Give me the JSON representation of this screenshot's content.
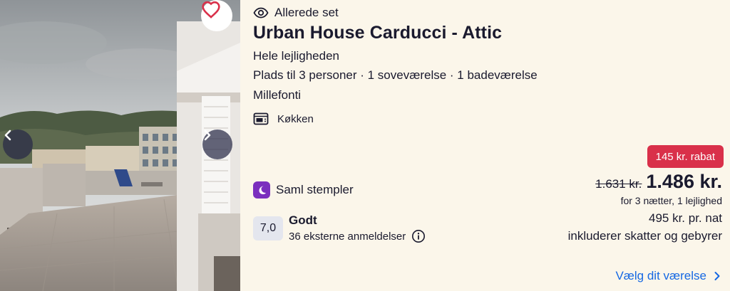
{
  "listing": {
    "seen_label": "Allerede set",
    "title": "Urban House Carducci - Attic",
    "type": "Hele lejligheden",
    "capacity": "Plads til 3 personer · 1 soveværelse · 1 badeværelse",
    "neighborhood": "Millefonti",
    "amenity": "Køkken"
  },
  "rewards": {
    "label": "Saml stempler"
  },
  "rating": {
    "score": "7,0",
    "label": "Godt",
    "reviews": "36 eksterne anmeldelser"
  },
  "price": {
    "discount": "145 kr. rabat",
    "old": "1.631 kr.",
    "current": "1.486 kr.",
    "stay": "for 3 nætter, 1 lejlighed",
    "per_night": "495 kr. pr. nat",
    "taxes": "inkluderer skatter og gebyrer"
  },
  "cta": {
    "label": "Vælg dit værelse"
  },
  "icons": {
    "favorite": "heart-icon",
    "seen": "eye-icon",
    "kitchen": "kitchen-icon",
    "stamps": "moon-icon",
    "info": "info-icon",
    "prev": "chevron-left-icon",
    "next": "chevron-right-icon",
    "cta_arrow": "chevron-right-icon"
  },
  "colors": {
    "background": "#fbf6ea",
    "discount": "#d9304a",
    "link": "#1668e3",
    "stamp": "#7b2fbe",
    "heart": "#d9304a"
  }
}
